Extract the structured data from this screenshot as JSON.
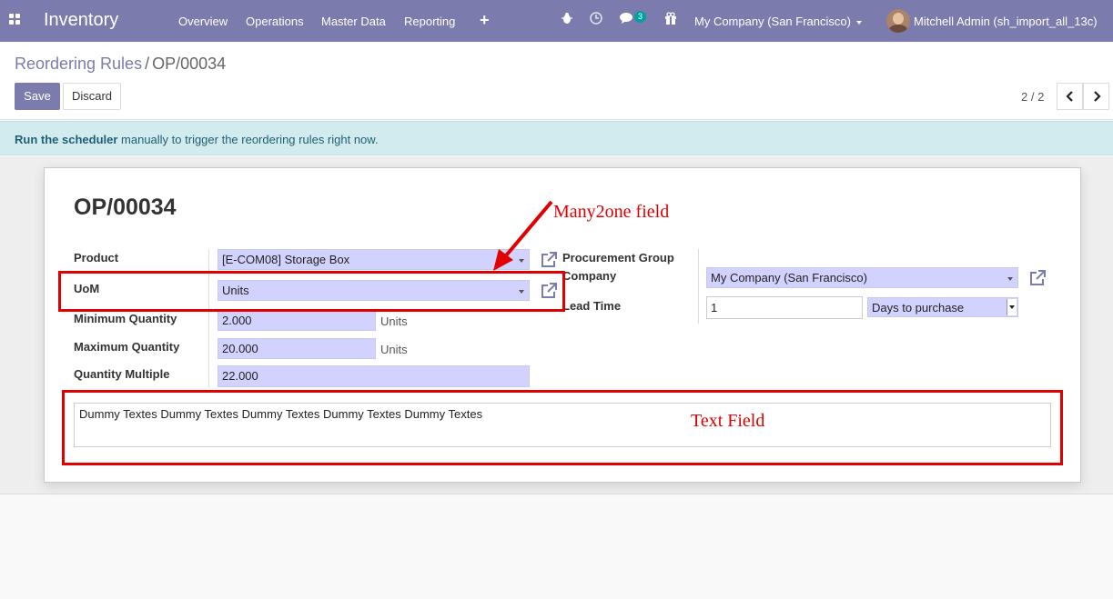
{
  "navbar": {
    "brand": "Inventory",
    "menu": [
      "Overview",
      "Operations",
      "Master Data",
      "Reporting"
    ],
    "messages_count": "3",
    "company": "My Company (San Francisco)",
    "user": "Mitchell Admin (sh_import_all_13c)"
  },
  "breadcrumb": {
    "parent": "Reordering Rules",
    "separator": "/",
    "current": "OP/00034"
  },
  "buttons": {
    "save": "Save",
    "discard": "Discard"
  },
  "pager": {
    "value": "2 / 2"
  },
  "alert": {
    "bold": "Run the scheduler",
    "text": " manually to trigger the reordering rules right now."
  },
  "form": {
    "title": "OP/00034",
    "labels": {
      "product": "Product",
      "uom": "UoM",
      "min_qty": "Minimum Quantity",
      "max_qty": "Maximum Quantity",
      "qty_multiple": "Quantity Multiple",
      "procurement_group": "Procurement Group",
      "company": "Company",
      "lead_time": "Lead Time"
    },
    "values": {
      "product": "[E-COM08] Storage Box",
      "uom": "Units",
      "min_qty": "2.000",
      "min_qty_unit": "Units",
      "max_qty": "20.000",
      "max_qty_unit": "Units",
      "qty_multiple": "22.000",
      "company": "My Company (San Francisco)",
      "lead_days": "1",
      "lead_type": "Days to purchase",
      "note": "Dummy Textes Dummy Textes Dummy Textes Dummy Textes Dummy Textes"
    }
  },
  "annotations": {
    "many2one": "Many2one field",
    "text_field": "Text Field",
    "color": "#e00000"
  },
  "colors": {
    "navbar": "#7c7bad",
    "primary": "#7c7bad",
    "field_bg": "#d2d2ff",
    "alert_bg": "#d2ebef"
  }
}
